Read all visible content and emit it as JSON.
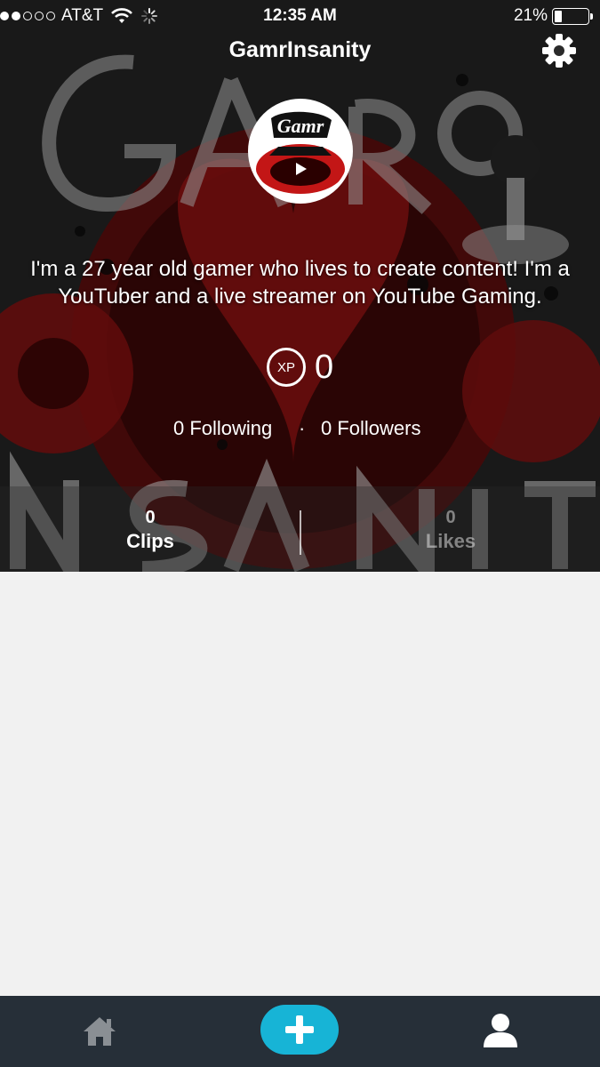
{
  "status_bar": {
    "carrier": "AT&T",
    "time": "12:35 AM",
    "battery": "21%",
    "battery_level": 0.21,
    "signal_bars": 2,
    "signal_total": 5
  },
  "header": {
    "title": "GamrInsanity",
    "settings_icon": "gear-icon"
  },
  "profile": {
    "avatar_text": "Gamr",
    "bio": "I'm a 27 year old gamer who lives to create content! I'm a YouTuber and a live streamer on YouTube Gaming.",
    "xp_badge": "XP",
    "xp_value": "0",
    "following": "0 Following",
    "separator": "·",
    "followers": "0 Followers"
  },
  "stats": {
    "clips_count": "0",
    "clips_label": "Clips",
    "likes_count": "0",
    "likes_label": "Likes"
  },
  "tabbar": {
    "home_icon": "home-icon",
    "add_icon": "plus-icon",
    "profile_icon": "profile-icon",
    "accent": "#17b4d6",
    "background": "#262f38"
  }
}
